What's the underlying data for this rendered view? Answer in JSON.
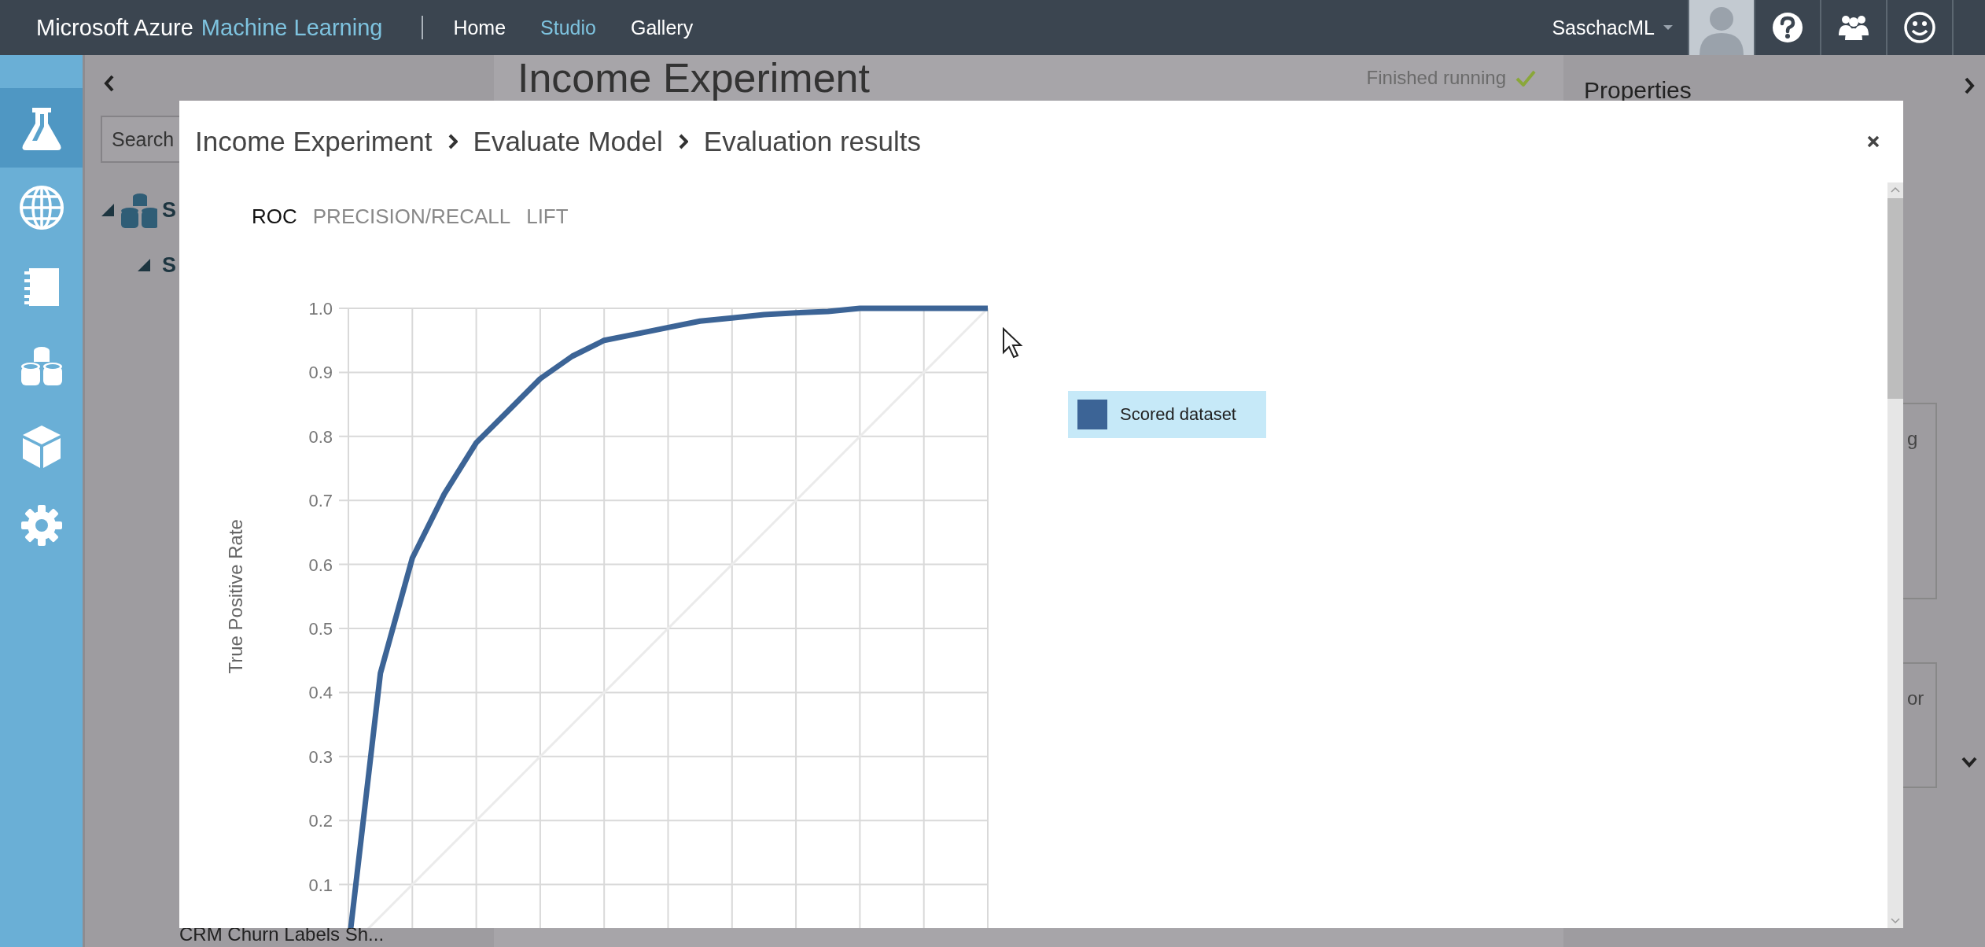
{
  "top_bar": {
    "brand": "Microsoft Azure",
    "brand_product": "Machine Learning",
    "nav": [
      {
        "label": "Home",
        "selected": false
      },
      {
        "label": "Studio",
        "selected": true
      },
      {
        "label": "Gallery",
        "selected": false
      }
    ],
    "user": "SaschacML"
  },
  "sidebar": {
    "items": [
      {
        "kind": "experiments",
        "selected": true
      },
      {
        "kind": "web_services",
        "selected": false
      },
      {
        "kind": "notebooks",
        "selected": false
      },
      {
        "kind": "datasets",
        "selected": false
      },
      {
        "kind": "models",
        "selected": false
      },
      {
        "kind": "settings",
        "selected": false
      }
    ]
  },
  "palette": {
    "search": {
      "placeholder": "Search"
    },
    "tree": [
      {
        "label": "S",
        "expanded": true,
        "children": [
          {
            "label": "S",
            "expanded": true
          }
        ]
      }
    ],
    "bottom_item": "CRM Churn Labels Sh..."
  },
  "experiment": {
    "title": "Income Experiment",
    "status": "Finished running"
  },
  "properties": {
    "title": "Properties",
    "fields": [
      "g",
      "or"
    ]
  },
  "dialog": {
    "breadcrumb": [
      "Income Experiment",
      "Evaluate Model",
      "Evaluation results"
    ],
    "tabs": [
      {
        "label": "ROC",
        "selected": true
      },
      {
        "label": "PRECISION/RECALL",
        "selected": false
      },
      {
        "label": "LIFT",
        "selected": false
      }
    ],
    "chart_data": {
      "type": "line",
      "ylabel": "True Positive Rate",
      "ylim": [
        0,
        1
      ],
      "grid": true,
      "categories": [
        null,
        null,
        null,
        null,
        null,
        null,
        null,
        null,
        null,
        null,
        null,
        null,
        null,
        null,
        null,
        null,
        null,
        null,
        null,
        null,
        null
      ],
      "yticks": [
        {
          "value": 0.1,
          "label": "0.1"
        },
        {
          "value": 0.2,
          "label": "0.2"
        },
        {
          "value": 0.3,
          "label": "0.3"
        },
        {
          "value": 0.4,
          "label": "0.4"
        },
        {
          "value": 0.5,
          "label": "0.5"
        },
        {
          "value": 0.6,
          "label": "0.6"
        },
        {
          "value": 0.7,
          "label": "0.7"
        },
        {
          "value": 0.8,
          "label": "0.8"
        },
        {
          "value": 0.9,
          "label": "0.9"
        },
        {
          "value": 1.0,
          "label": "1.0"
        }
      ],
      "series": [
        {
          "name": "Scored dataset",
          "color": "#3c6496",
          "values": [
            0,
            0.43,
            0.61,
            0.71,
            0.79,
            0.84,
            0.89,
            0.925,
            0.95,
            0.96,
            0.97,
            0.98,
            0.985,
            0.99,
            0.993,
            0.995,
            1.0,
            1.0,
            1.0,
            1.0,
            1.0
          ]
        }
      ]
    }
  }
}
